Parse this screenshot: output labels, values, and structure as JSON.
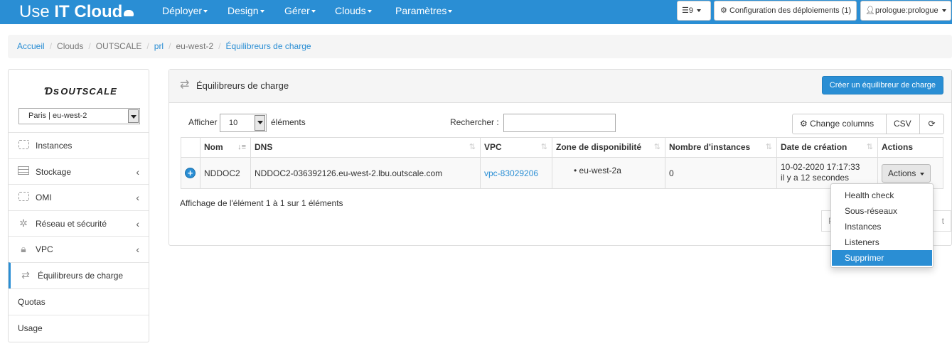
{
  "brand": {
    "prefix": "Use ",
    "name": "IT Cloud"
  },
  "nav": {
    "menus": [
      "Déployer",
      "Design",
      "Gérer",
      "Clouds",
      "Paramètres"
    ],
    "tasks_count": "9",
    "deploy_config": "Configuration des déploiements (1)",
    "user": "prologue:prologue"
  },
  "breadcrumb": [
    "Accueil",
    "Clouds",
    "OUTSCALE",
    "prl",
    "eu-west-2",
    "Équilibreurs de charge"
  ],
  "sidebar": {
    "logo": "OUTSCALE",
    "region": "Paris | eu-west-2",
    "items": [
      {
        "label": "Instances"
      },
      {
        "label": "Stockage"
      },
      {
        "label": "OMI"
      },
      {
        "label": "Réseau et sécurité"
      },
      {
        "label": "VPC"
      },
      {
        "label": "Équilibreurs de charge"
      },
      {
        "label": "Quotas"
      },
      {
        "label": "Usage"
      }
    ]
  },
  "panel": {
    "title": "Équilibreurs de charge",
    "create_button": "Créer un équilibreur de charge",
    "show_label": "Afficher",
    "page_length": "10",
    "elements_label": "éléments",
    "search_label": "Rechercher :",
    "search_value": "",
    "change_columns": "Change columns",
    "csv": "CSV",
    "info": "Affichage de l'élément 1 à 1 sur 1 éléments"
  },
  "table": {
    "columns": [
      "Nom",
      "DNS",
      "VPC",
      "Zone de disponibilité",
      "Nombre d'instances",
      "Date de création",
      "Actions"
    ],
    "rows": [
      {
        "name": "NDDOC2",
        "dns": "NDDOC2-036392126.eu-west-2.lbu.outscale.com",
        "vpc": "vpc-83029206",
        "zone": "eu-west-2a",
        "instances": "0",
        "date": "10-02-2020 17:17:33",
        "date_relative": "il y a 12 secondes",
        "actions": "Actions"
      }
    ]
  },
  "pager": {
    "first": "P",
    "last": "t"
  },
  "actions_menu": [
    "Health check",
    "Sous-réseaux",
    "Instances",
    "Listeners",
    "Supprimer"
  ],
  "colors": {
    "accent": "#2a8ed4"
  }
}
